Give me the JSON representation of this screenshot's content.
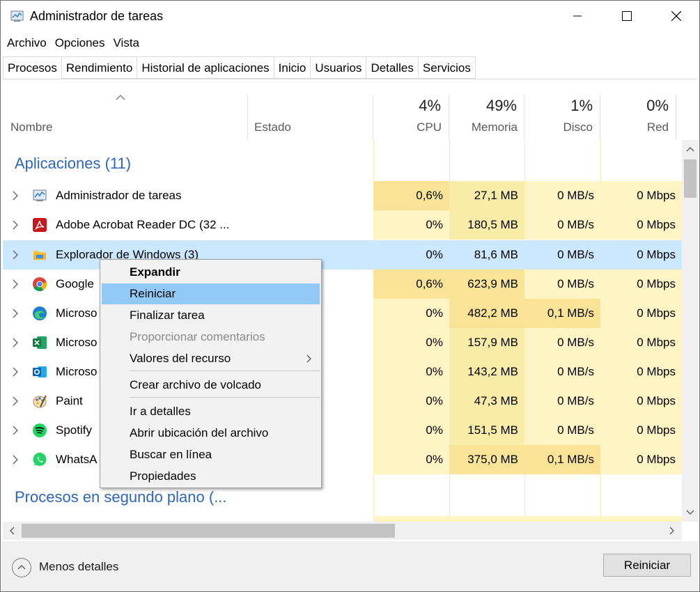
{
  "window": {
    "title": "Administrador de tareas",
    "icon": "task-manager-icon"
  },
  "menu": [
    "Archivo",
    "Opciones",
    "Vista"
  ],
  "tabs": [
    "Procesos",
    "Rendimiento",
    "Historial de aplicaciones",
    "Inicio",
    "Usuarios",
    "Detalles",
    "Servicios"
  ],
  "active_tab": "Procesos",
  "columns": {
    "name": "Nombre",
    "status": "Estado",
    "cpu": {
      "pct": "4%",
      "label": "CPU"
    },
    "memory": {
      "pct": "49%",
      "label": "Memoria"
    },
    "disk": {
      "pct": "1%",
      "label": "Disco"
    },
    "network": {
      "pct": "0%",
      "label": "Red"
    }
  },
  "groups": {
    "apps": "Aplicaciones (11)",
    "background": "Procesos en segundo plano (..."
  },
  "rows": [
    {
      "name": "Administrador de tareas",
      "icon": "task-manager-icon",
      "cpu": "0,6%",
      "mem": "27,1 MB",
      "disk": "0 MB/s",
      "net": "0 Mbps"
    },
    {
      "name": "Adobe Acrobat Reader DC (32 ...",
      "icon": "acrobat-icon",
      "cpu": "0%",
      "mem": "180,5 MB",
      "disk": "0 MB/s",
      "net": "0 Mbps"
    },
    {
      "name": "Explorador de Windows (3)",
      "icon": "folder-icon",
      "cpu": "0%",
      "mem": "81,6 MB",
      "disk": "0 MB/s",
      "net": "0 Mbps"
    },
    {
      "name": "Google",
      "icon": "chrome-icon",
      "cpu": "0,6%",
      "mem": "623,9 MB",
      "disk": "0 MB/s",
      "net": "0 Mbps"
    },
    {
      "name": "Microso",
      "icon": "edge-icon",
      "cpu": "0%",
      "mem": "482,2 MB",
      "disk": "0,1 MB/s",
      "net": "0 Mbps"
    },
    {
      "name": "Microso",
      "icon": "excel-icon",
      "cpu": "0%",
      "mem": "157,9 MB",
      "disk": "0 MB/s",
      "net": "0 Mbps"
    },
    {
      "name": "Microso",
      "icon": "outlook-icon",
      "cpu": "0%",
      "mem": "143,2 MB",
      "disk": "0 MB/s",
      "net": "0 Mbps"
    },
    {
      "name": "Paint",
      "icon": "paint-icon",
      "cpu": "0%",
      "mem": "47,3 MB",
      "disk": "0 MB/s",
      "net": "0 Mbps"
    },
    {
      "name": "Spotify",
      "icon": "spotify-icon",
      "cpu": "0%",
      "mem": "151,5 MB",
      "disk": "0 MB/s",
      "net": "0 Mbps"
    },
    {
      "name": "WhatsA",
      "icon": "whatsapp-icon",
      "cpu": "0%",
      "mem": "375,0 MB",
      "disk": "0,1 MB/s",
      "net": "0 Mbps"
    }
  ],
  "context_menu": [
    "Expandir",
    "Reiniciar",
    "Finalizar tarea",
    "Proporcionar comentarios",
    "Valores del recurso",
    "Crear archivo de volcado",
    "Ir a detalles",
    "Abrir ubicación del archivo",
    "Buscar en línea",
    "Propiedades"
  ],
  "footer": {
    "less_details": "Menos detalles",
    "restart_button": "Reiniciar"
  },
  "colors": {
    "accent": "#2d66b9",
    "selection": "#cce8ff",
    "menu_highlight": "#91c9f7",
    "heat_light": "#fff4c4",
    "heat_mid": "#f9eca8",
    "heat_strong": "#f9e396"
  }
}
